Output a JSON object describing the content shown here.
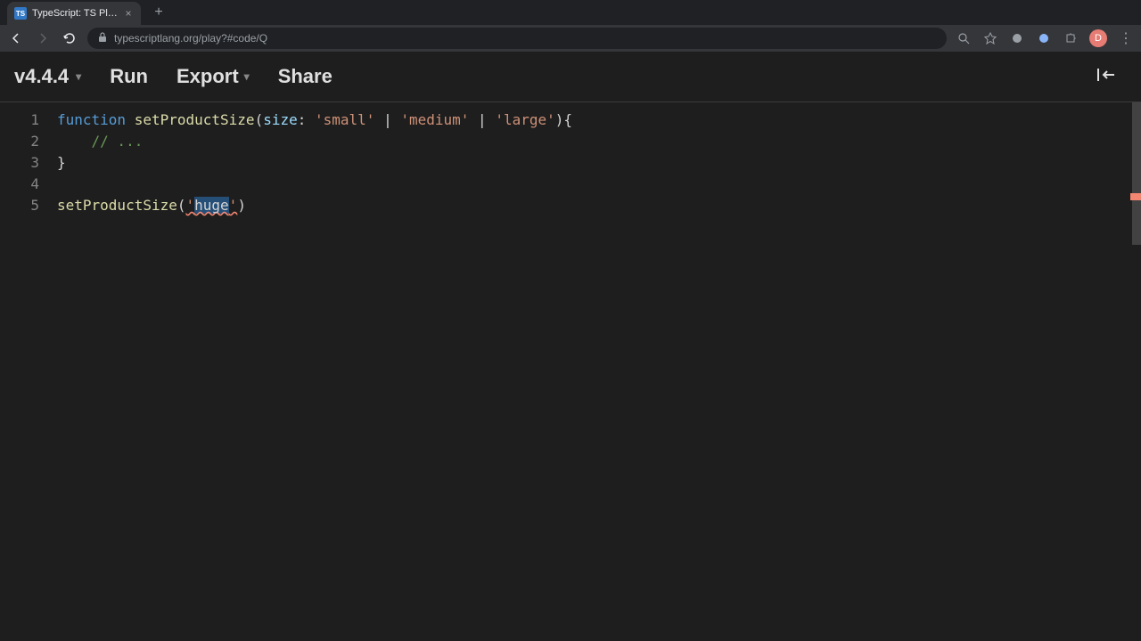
{
  "browser": {
    "tab": {
      "favicon_text": "TS",
      "title": "TypeScript: TS Playground - A"
    },
    "url": "typescriptlang.org/play?#code/Q",
    "avatar_letter": "D"
  },
  "toolbar": {
    "version": "v4.4.4",
    "run": "Run",
    "export": "Export",
    "share": "Share"
  },
  "editor": {
    "line_numbers": [
      "1",
      "2",
      "3",
      "4",
      "5"
    ],
    "line1": {
      "kw_function": "function",
      "func": "setProductSize",
      "lparen": "(",
      "param": "size",
      "colon": ": ",
      "str1": "'small'",
      "pipe1": " | ",
      "str2": "'medium'",
      "pipe2": " | ",
      "str3": "'large'",
      "rparen_brace": "){"
    },
    "line2": {
      "indent": "    ",
      "comment": "// ..."
    },
    "line3": {
      "brace": "}"
    },
    "line5": {
      "func": "setProductSize",
      "lparen": "(",
      "quote1": "'",
      "arg": "huge",
      "quote2": "'",
      "rparen": ")"
    }
  }
}
